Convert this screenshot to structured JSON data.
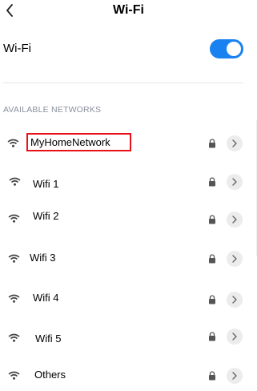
{
  "header": {
    "title": "Wi-Fi",
    "back_icon": "chevron-left-icon"
  },
  "wifi_toggle": {
    "label": "Wi-Fi",
    "enabled": true,
    "accent_color": "#1a82f0"
  },
  "section": {
    "title": "AVAILABLE NETWORKS"
  },
  "networks": [
    {
      "name": "MyHomeNetwork",
      "secured": true,
      "highlighted": true
    },
    {
      "name": "Wifi 1",
      "secured": true
    },
    {
      "name": "Wifi 2",
      "secured": true
    },
    {
      "name": "Wifi 3",
      "secured": true
    },
    {
      "name": "Wifi 4",
      "secured": true
    },
    {
      "name": "Wifi 5",
      "secured": true
    },
    {
      "name": "Others",
      "secured": true
    }
  ],
  "colors": {
    "highlight_border": "#e8111a",
    "section_text": "#8a8f9c"
  }
}
